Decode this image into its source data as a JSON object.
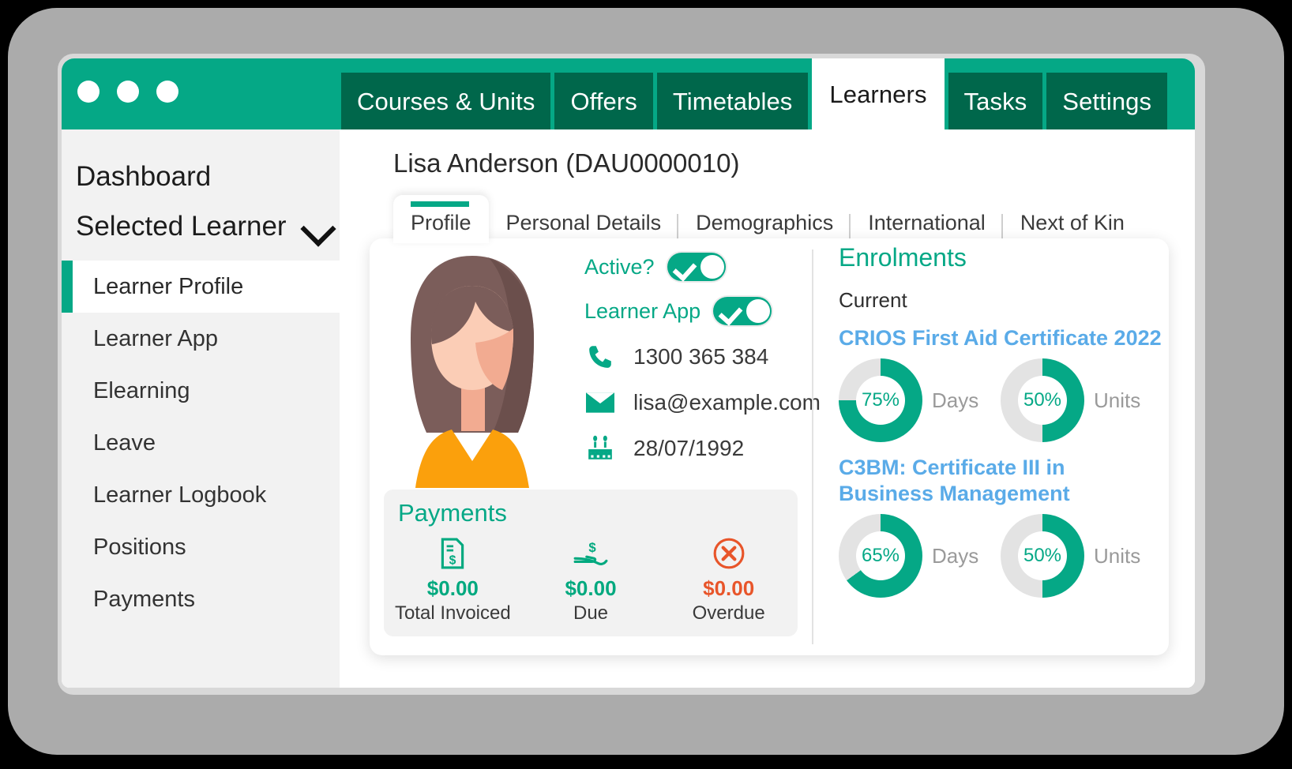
{
  "colors": {
    "brand_green": "#05a886",
    "tab_green": "#00674b",
    "link_blue": "#5aabe8",
    "danger_orange": "#e8552a",
    "frame_gray": "#ababab"
  },
  "window": {
    "nav_tabs": [
      {
        "label": "Courses & Units",
        "active": false
      },
      {
        "label": "Offers",
        "active": false
      },
      {
        "label": "Timetables",
        "active": false
      },
      {
        "label": "Learners",
        "active": true
      },
      {
        "label": "Tasks",
        "active": false
      },
      {
        "label": "Settings",
        "active": false
      }
    ]
  },
  "sidebar": {
    "title": "Dashboard",
    "selected_learner_label": "Selected Learner",
    "items": [
      {
        "label": "Learner Profile",
        "active": true
      },
      {
        "label": "Learner App",
        "active": false
      },
      {
        "label": "Elearning",
        "active": false
      },
      {
        "label": "Leave",
        "active": false
      },
      {
        "label": "Learner Logbook",
        "active": false
      },
      {
        "label": "Positions",
        "active": false
      },
      {
        "label": "Payments",
        "active": false
      }
    ]
  },
  "main": {
    "learner_name": "Lisa Anderson (DAU0000010)",
    "profile_tabs": [
      {
        "label": "Profile",
        "active": true
      },
      {
        "label": "Personal Details",
        "active": false
      },
      {
        "label": "Demographics",
        "active": false
      },
      {
        "label": "International",
        "active": false
      },
      {
        "label": "Next of Kin",
        "active": false
      }
    ],
    "profile": {
      "toggles": [
        {
          "label": "Active?",
          "on": true
        },
        {
          "label": "Learner App",
          "on": true
        }
      ],
      "contact": [
        {
          "icon": "phone-icon",
          "value": "1300 365 384"
        },
        {
          "icon": "email-icon",
          "value": "lisa@example.com"
        },
        {
          "icon": "birthday-cake-icon",
          "value": "28/07/1992"
        }
      ]
    },
    "payments": {
      "title": "Payments",
      "cells": [
        {
          "icon": "invoice-document-icon",
          "amount": "$0.00",
          "label": "Total Invoiced",
          "danger": false
        },
        {
          "icon": "hand-money-icon",
          "amount": "$0.00",
          "label": "Due",
          "danger": false
        },
        {
          "icon": "overdue-x-circle-icon",
          "amount": "$0.00",
          "label": "Overdue",
          "danger": true
        }
      ]
    },
    "enrolments": {
      "title": "Enrolments",
      "subtitle": "Current",
      "courses": [
        {
          "name": "CRIOS First Aid Certificate 2022",
          "rings": [
            {
              "percent_label": "75%",
              "percent": 75,
              "label": "Days"
            },
            {
              "percent_label": "50%",
              "percent": 50,
              "label": "Units"
            }
          ]
        },
        {
          "name": "C3BM: Certificate III in Business Management",
          "rings": [
            {
              "percent_label": "65%",
              "percent": 65,
              "label": "Days"
            },
            {
              "percent_label": "50%",
              "percent": 50,
              "label": "Units"
            }
          ]
        }
      ]
    }
  }
}
